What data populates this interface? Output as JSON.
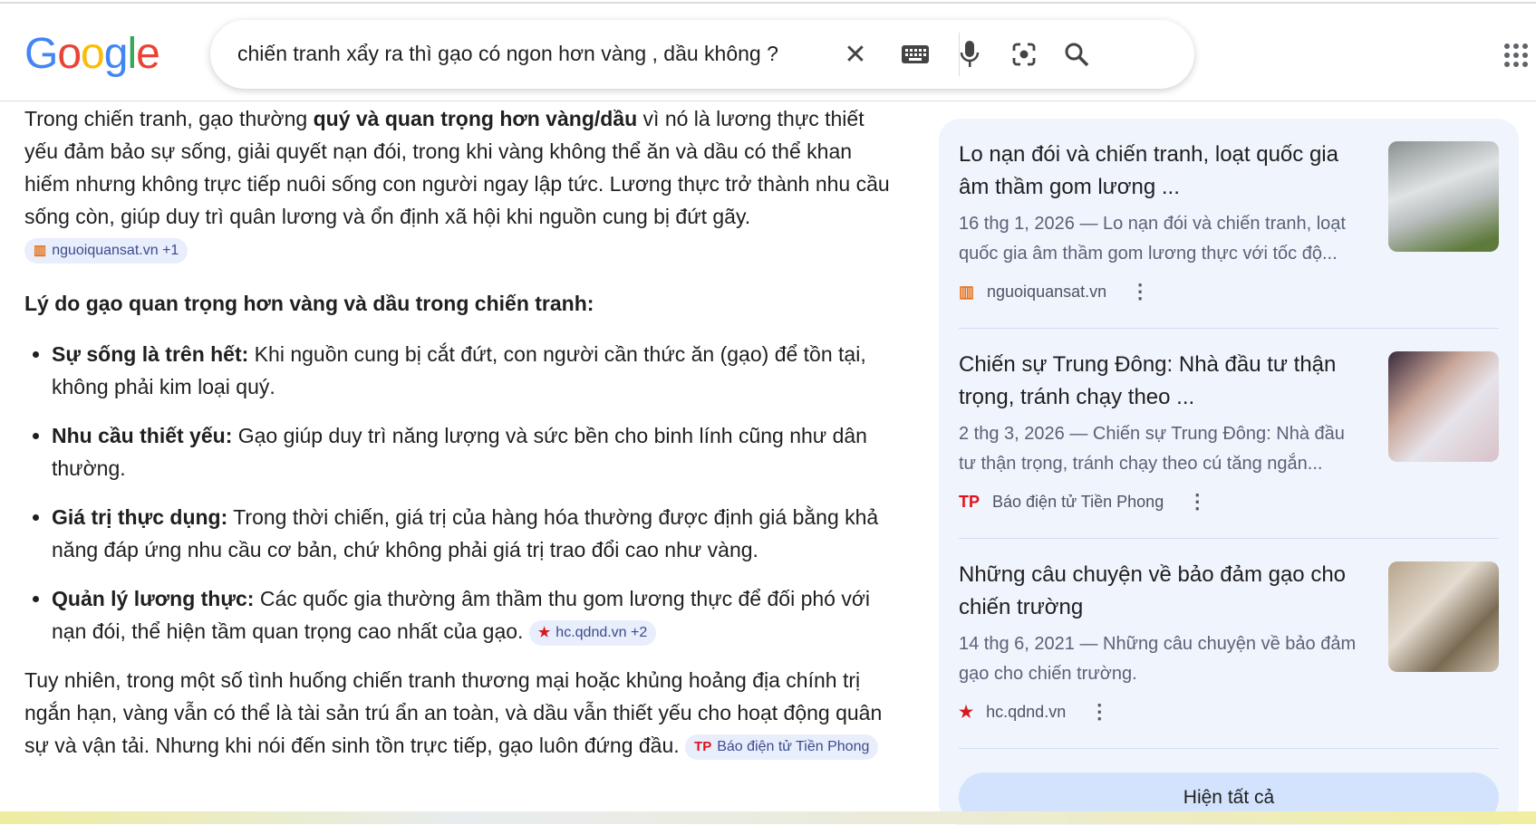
{
  "header": {
    "logo": "Google",
    "query": "chiến tranh xẩy ra thì gạo có ngon hơn vàng , dầu không ?",
    "icons": [
      "close-icon",
      "keyboard-icon",
      "microphone-icon",
      "lens-icon",
      "search-icon",
      "apps-icon"
    ]
  },
  "answer": {
    "intro_a": "Trong chiến tranh, gạo thường ",
    "intro_bold": "quý và quan trọng hơn vàng/dầu",
    "intro_b": " vì nó là lương thực thiết yếu đảm bảo sự sống, giải quyết nạn đói, trong khi vàng không thể ăn và dầu có thể khan hiếm nhưng không trực tiếp nuôi sống con người ngay lập tức. Lương thực trở thành nhu cầu sống còn, giúp duy trì quân lương và ổn định xã hội khi nguồn cung bị đứt gãy.",
    "intro_chip": "nguoiquansat.vn +1",
    "heading": "Lý do gạo quan trọng hơn vàng và dầu trong chiến tranh:",
    "bullets": [
      {
        "bold": "Sự sống là trên hết:",
        "text": " Khi nguồn cung bị cắt đứt, con người cần thức ăn (gạo) để tồn tại, không phải kim loại quý."
      },
      {
        "bold": "Nhu cầu thiết yếu:",
        "text": " Gạo giúp duy trì năng lượng và sức bền cho binh lính cũng như dân thường."
      },
      {
        "bold": "Giá trị thực dụng:",
        "text": " Trong thời chiến, giá trị của hàng hóa thường được định giá bằng khả năng đáp ứng nhu cầu cơ bản, chứ không phải giá trị trao đổi cao như vàng."
      },
      {
        "bold": "Quản lý lương thực:",
        "text": " Các quốc gia thường âm thầm thu gom lương thực để đối phó với nạn đói, thể hiện tầm quan trọng cao nhất của gạo. ",
        "chip": "hc.qdnd.vn +2"
      }
    ],
    "outro": "Tuy nhiên, trong một số tình huống chiến tranh thương mại hoặc khủng hoảng địa chính trị ngắn hạn, vàng vẫn có thể là tài sản trú ẩn an toàn, và dầu vẫn thiết yếu cho hoạt động quân sự và vận tải. Nhưng khi nói đến sinh tồn trực tiếp, gạo luôn đứng đầu.",
    "outro_chip": "Báo điện tử Tiền Phong"
  },
  "sources": [
    {
      "title": "Lo nạn đói và chiến tranh, loạt quốc gia âm thầm gom lương ...",
      "snippet": "16 thg 1, 2026 — Lo nạn đói và chiến tranh, loạt quốc gia âm thầm gom lương thực với tốc độ...",
      "site": "nguoiquansat.vn"
    },
    {
      "title": "Chiến sự Trung Đông: Nhà đầu tư thận trọng, tránh chạy theo ...",
      "snippet": "2 thg 3, 2026 — Chiến sự Trung Đông: Nhà đầu tư thận trọng, tránh chạy theo cú tăng ngắn...",
      "site": "Báo điện tử Tiền Phong"
    },
    {
      "title": "Những câu chuyện về bảo đảm gạo cho chiến trường",
      "snippet": "14 thg 6, 2021 — Những câu chuyện về bảo đảm gạo cho chiến trường.",
      "site": "hc.qdnd.vn"
    }
  ],
  "show_all": "Hiện tất cả",
  "colors": {
    "card_bg": "#f0f4fd",
    "chip_bg": "#e8eefc",
    "button_bg": "#d3e3fd"
  }
}
